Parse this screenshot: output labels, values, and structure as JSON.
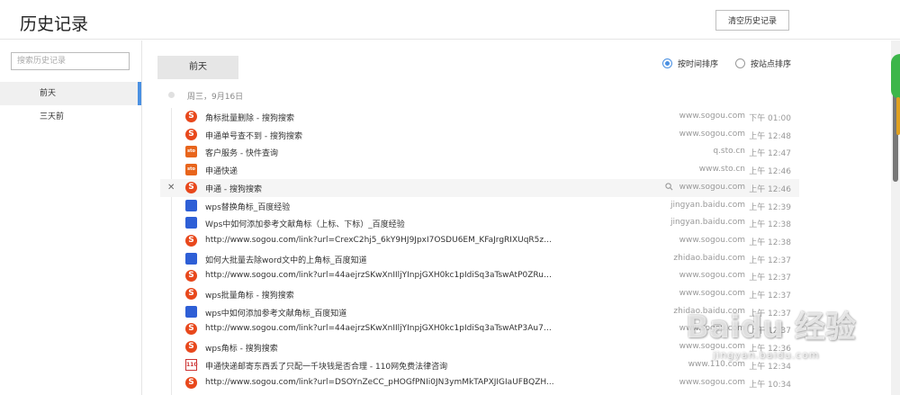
{
  "header": {
    "title": "历史记录",
    "clear_label": "清空历史记录"
  },
  "sidebar": {
    "search_placeholder": "搜索历史记录",
    "items": [
      {
        "label": "前天"
      },
      {
        "label": "三天前"
      }
    ]
  },
  "main": {
    "day_tab": "前天",
    "sort": {
      "by_time": "按时间排序",
      "by_site": "按站点排序",
      "selected": "by_time"
    },
    "date_label": "周三，9月16日",
    "rows": [
      {
        "icon": "sogou-icon",
        "title": "角标批量删除 - 搜狗搜索",
        "domain": "www.sogou.com",
        "time": "下午 01:00"
      },
      {
        "icon": "sogou-icon",
        "title": "申通单号查不到 - 搜狗搜索",
        "domain": "www.sogou.com",
        "time": "上午 12:48"
      },
      {
        "icon": "sto-icon",
        "title": "客户服务 - 快件查询",
        "domain": "q.sto.cn",
        "time": "上午 12:47"
      },
      {
        "icon": "sto-icon",
        "title": "申通快递",
        "domain": "www.sto.cn",
        "time": "上午 12:46"
      },
      {
        "icon": "sogou-icon",
        "title": "申通 - 搜狗搜索",
        "domain": "www.sogou.com",
        "time": "上午 12:46"
      },
      {
        "icon": "baidu-icon",
        "title": "wps替换角标_百度经验",
        "domain": "jingyan.baidu.com",
        "time": "上午 12:39"
      },
      {
        "icon": "baidu-icon",
        "title": "Wps中如何添加参考文献角标（上标、下标）_百度经验",
        "domain": "jingyan.baidu.com",
        "time": "上午 12:38"
      },
      {
        "icon": "sogou-icon",
        "title": "http://www.sogou.com/link?url=CrexC2hj5_6kY9HJ9JpxI7OSDU6EM_KFaJrgRIXUqR5zRT...",
        "domain": "www.sogou.com",
        "time": "上午 12:38"
      },
      {
        "icon": "baidu-icon",
        "title": "如何大批量去除word文中的上角标_百度知道",
        "domain": "zhidao.baidu.com",
        "time": "上午 12:37"
      },
      {
        "icon": "sogou-icon",
        "title": "http://www.sogou.com/link?url=44aejrzSKwXnIIljYInpjGXH0kc1pIdiSq3aTswAtP0ZRuO76...",
        "domain": "www.sogou.com",
        "time": "上午 12:37"
      },
      {
        "icon": "sogou-icon",
        "title": "wps批量角标 - 搜狗搜索",
        "domain": "www.sogou.com",
        "time": "上午 12:37"
      },
      {
        "icon": "baidu-icon",
        "title": "wps中如何添加参考文献角标_百度知道",
        "domain": "zhidao.baidu.com",
        "time": "上午 12:37"
      },
      {
        "icon": "sogou-icon",
        "title": "http://www.sogou.com/link?url=44aejrzSKwXnIIljYInpjGXH0kc1pIdiSq3aTswAtP3Au7bxR...",
        "domain": "www.sogou.com",
        "time": "上午 12:37"
      },
      {
        "icon": "sogou-icon",
        "title": "wps角标 - 搜狗搜索",
        "domain": "www.sogou.com",
        "time": "上午 12:36"
      },
      {
        "icon": "110-icon",
        "title": "申通快递邮寄东西丢了只配一千块钱是否合理 - 110网免费法律咨询",
        "domain": "www.110.com",
        "time": "上午 12:34"
      },
      {
        "icon": "sogou-icon",
        "title": "http://www.sogou.com/link?url=DSOYnZeCC_pHOGfPNIi0JN3ymMkTAPXJIGIaUFBQZH...",
        "domain": "www.sogou.com",
        "time": "上午 10:34"
      }
    ]
  },
  "watermark": {
    "main": "Baidu 经验",
    "sub": "jingyan.baidu.com"
  },
  "colors": {
    "accent": "#4a90e2",
    "sogou": "#e8481c",
    "baidu": "#2e5fd6"
  }
}
